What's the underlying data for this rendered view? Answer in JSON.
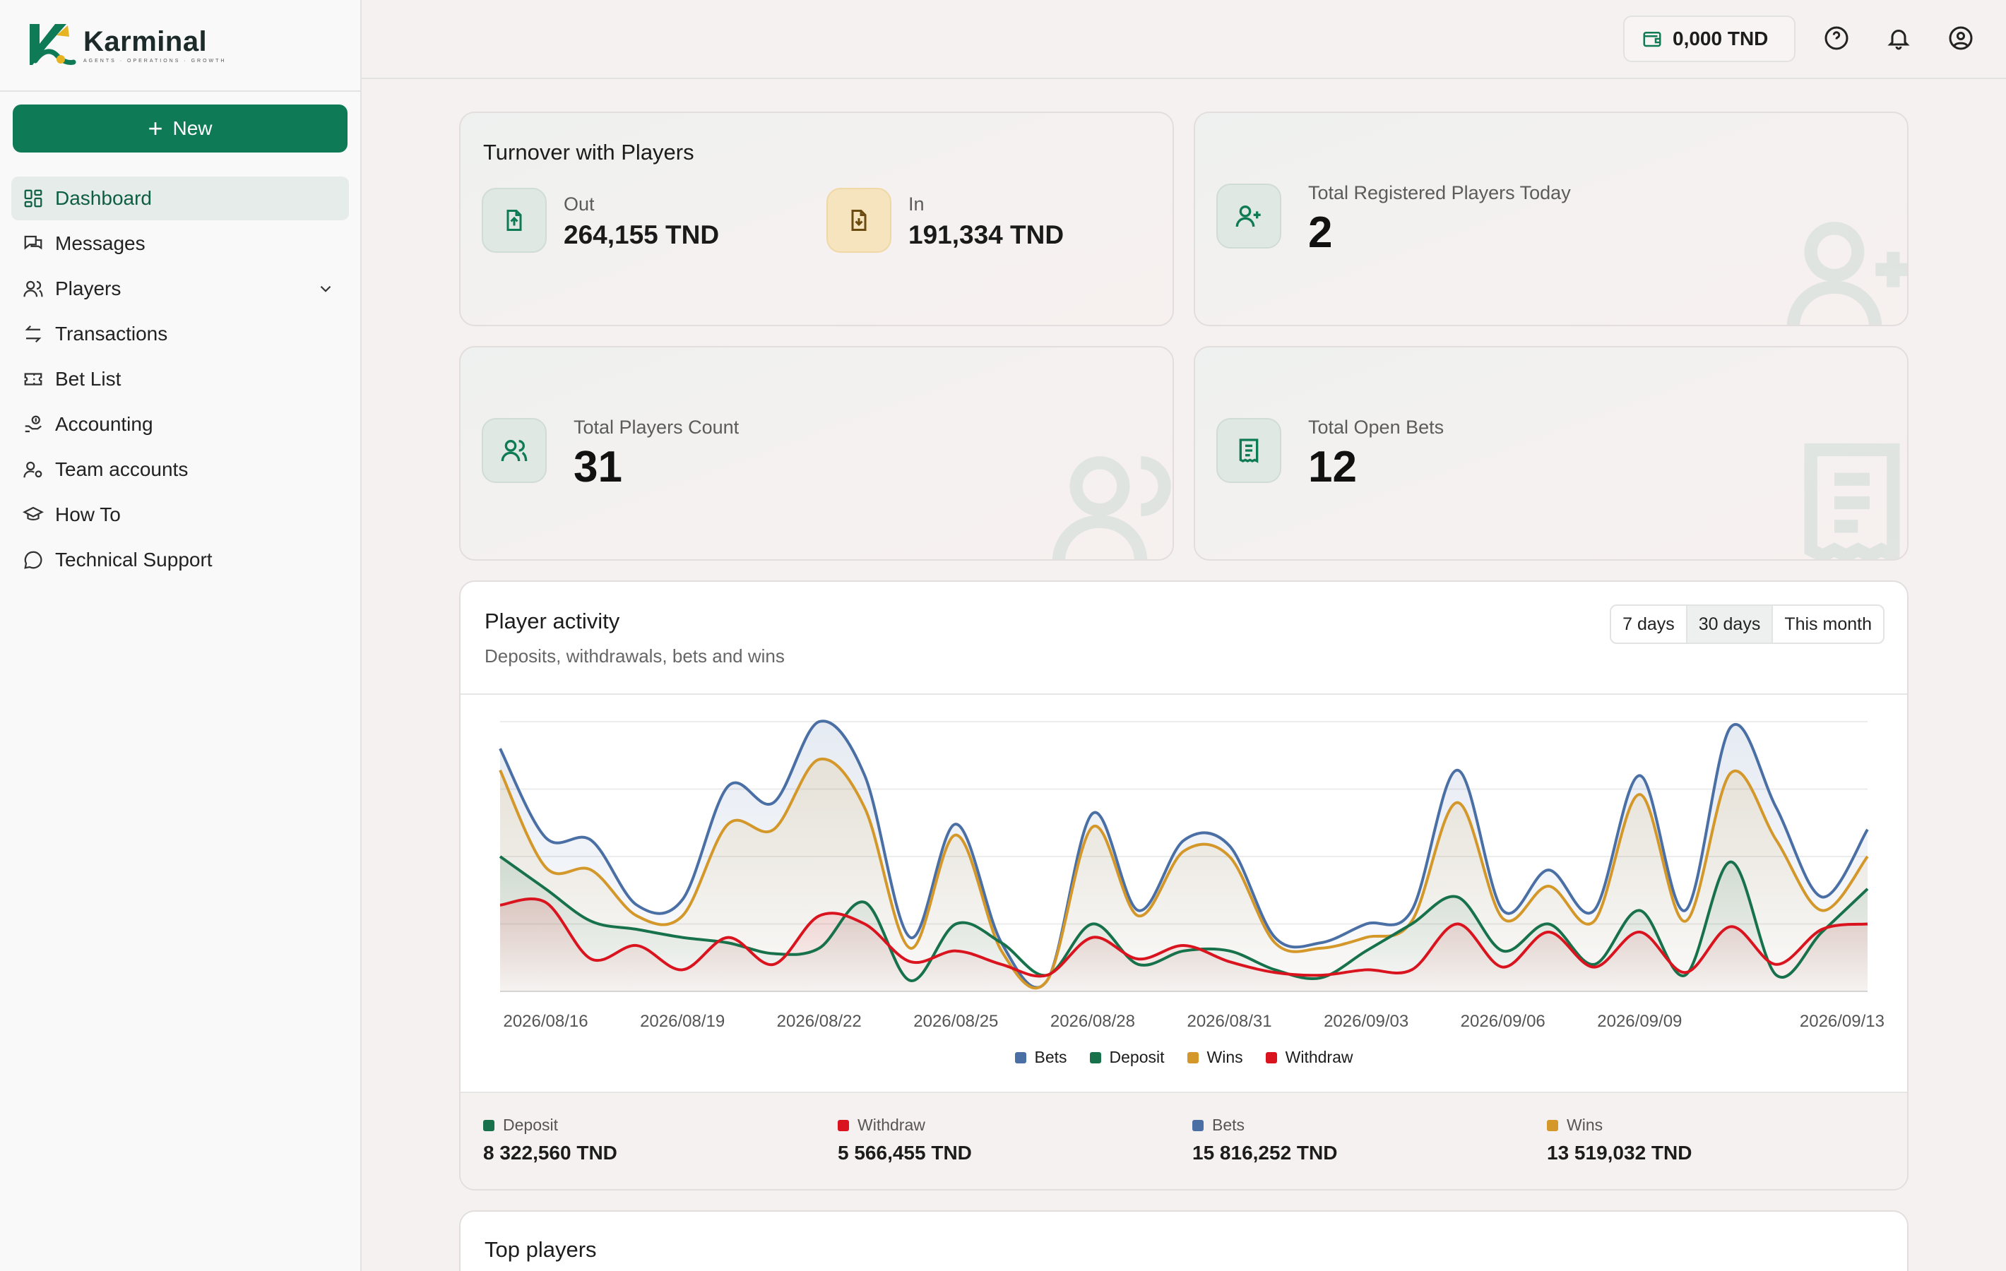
{
  "brand": {
    "name": "Karminal",
    "tagline": "AGENTS · OPERATIONS · GROWTH"
  },
  "sidebar": {
    "new_label": "New",
    "items": [
      {
        "label": "Dashboard",
        "icon": "dashboard-icon",
        "active": true
      },
      {
        "label": "Messages",
        "icon": "messages-icon"
      },
      {
        "label": "Players",
        "icon": "players-icon",
        "expandable": true
      },
      {
        "label": "Transactions",
        "icon": "transactions-icon"
      },
      {
        "label": "Bet List",
        "icon": "ticket-icon"
      },
      {
        "label": "Accounting",
        "icon": "accounting-icon"
      },
      {
        "label": "Team accounts",
        "icon": "team-icon"
      },
      {
        "label": "How To",
        "icon": "graduation-cap-icon"
      },
      {
        "label": "Technical Support",
        "icon": "chat-bubble-icon"
      }
    ]
  },
  "topbar": {
    "balance": "0,000 TND"
  },
  "turnover": {
    "title": "Turnover with Players",
    "out_label": "Out",
    "out_value": "264,155 TND",
    "in_label": "In",
    "in_value": "191,334 TND"
  },
  "registered_today": {
    "label": "Total Registered Players Today",
    "value": "2"
  },
  "players_count": {
    "label": "Total Players Count",
    "value": "31"
  },
  "open_bets": {
    "label": "Total Open Bets",
    "value": "12"
  },
  "activity": {
    "title": "Player activity",
    "subtitle": "Deposits, withdrawals, bets and wins",
    "ranges": [
      "7 days",
      "30 days",
      "This month"
    ],
    "selected_range": "30 days"
  },
  "colors": {
    "bets": "#4a6fa5",
    "deposit": "#17714a",
    "wins": "#d4982a",
    "withdraw": "#d9141f",
    "brand": "#0f7a56"
  },
  "chart_data": {
    "type": "area",
    "x": [
      "2026/08/15",
      "2026/08/16",
      "2026/08/17",
      "2026/08/18",
      "2026/08/19",
      "2026/08/20",
      "2026/08/21",
      "2026/08/22",
      "2026/08/23",
      "2026/08/24",
      "2026/08/25",
      "2026/08/26",
      "2026/08/27",
      "2026/08/28",
      "2026/08/29",
      "2026/08/30",
      "2026/08/31",
      "2026/09/01",
      "2026/09/02",
      "2026/09/03",
      "2026/09/04",
      "2026/09/05",
      "2026/09/06",
      "2026/09/07",
      "2026/09/08",
      "2026/09/09",
      "2026/09/10",
      "2026/09/11",
      "2026/09/12",
      "2026/09/13",
      "2026/09/14"
    ],
    "tick_labels": [
      "2026/08/16",
      "2026/08/19",
      "2026/08/22",
      "2026/08/25",
      "2026/08/28",
      "2026/08/31",
      "2026/09/03",
      "2026/09/06",
      "2026/09/09",
      "2026/09/13"
    ],
    "series": [
      {
        "name": "Bets",
        "values": [
          900,
          570,
          560,
          320,
          340,
          760,
          700,
          1000,
          800,
          200,
          620,
          180,
          40,
          660,
          300,
          560,
          540,
          200,
          180,
          250,
          300,
          820,
          300,
          450,
          300,
          800,
          300,
          980,
          680,
          350,
          600
        ]
      },
      {
        "name": "Deposit",
        "values": [
          500,
          380,
          260,
          230,
          200,
          180,
          140,
          160,
          330,
          40,
          250,
          180,
          60,
          250,
          100,
          150,
          150,
          80,
          50,
          150,
          250,
          350,
          150,
          250,
          100,
          300,
          60,
          480,
          60,
          220,
          380
        ]
      },
      {
        "name": "Wins",
        "values": [
          820,
          460,
          450,
          280,
          280,
          620,
          600,
          860,
          680,
          160,
          580,
          150,
          40,
          610,
          280,
          520,
          500,
          180,
          160,
          200,
          260,
          700,
          270,
          390,
          260,
          730,
          260,
          810,
          560,
          300,
          500
        ]
      },
      {
        "name": "Withdraw",
        "values": [
          320,
          330,
          120,
          170,
          80,
          200,
          100,
          280,
          250,
          110,
          150,
          100,
          60,
          200,
          120,
          170,
          110,
          70,
          60,
          80,
          80,
          250,
          90,
          220,
          90,
          220,
          70,
          240,
          100,
          230,
          250
        ]
      }
    ],
    "grid": true
  },
  "summary": [
    {
      "label": "Deposit",
      "value": "8 322,560 TND",
      "color": "#17714a"
    },
    {
      "label": "Withdraw",
      "value": "5 566,455 TND",
      "color": "#d9141f"
    },
    {
      "label": "Bets",
      "value": "15 816,252 TND",
      "color": "#4a6fa5"
    },
    {
      "label": "Wins",
      "value": "13 519,032 TND",
      "color": "#d4982a"
    }
  ],
  "top_players": {
    "title": "Top players"
  }
}
